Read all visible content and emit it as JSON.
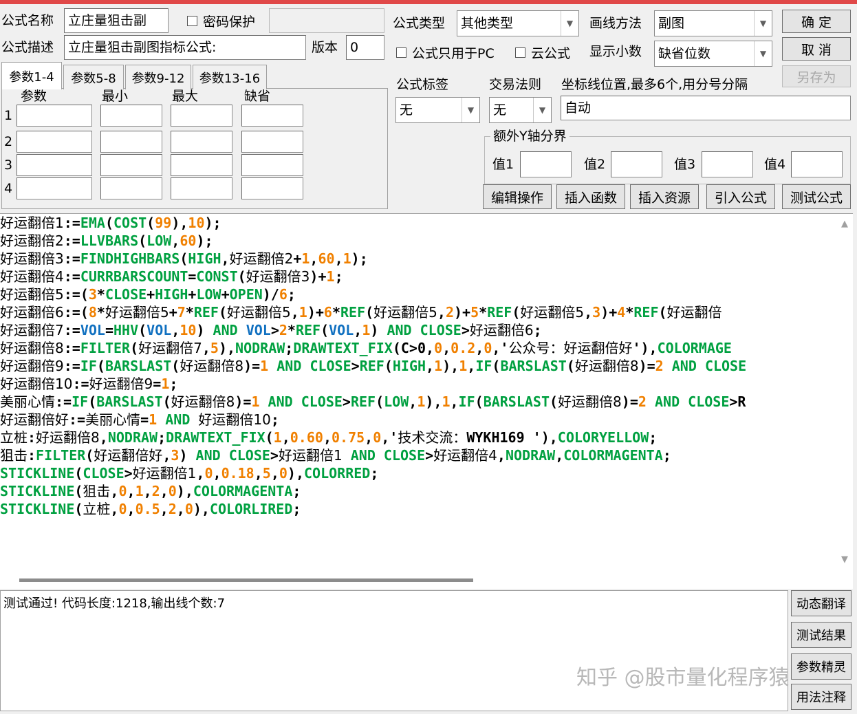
{
  "header": {
    "name_label": "公式名称",
    "name_value": "立庄量狙击副",
    "password_label": "密码保护",
    "desc_label": "公式描述",
    "desc_value": "立庄量狙击副图指标公式:",
    "version_label": "版本",
    "version_value": "0",
    "type_label": "公式类型",
    "type_value": "其他类型",
    "draw_label": "画线方法",
    "draw_value": "副图",
    "pc_only_label": "公式只用于PC",
    "cloud_label": "云公式",
    "decimals_label": "显示小数",
    "decimals_value": "缺省位数",
    "tag_label": "公式标签",
    "tag_value": "无",
    "trade_label": "交易法则",
    "trade_value": "无",
    "coord_label": "坐标线位置,最多6个,用分号分隔",
    "coord_value": "自动",
    "extra_y_label": "额外Y轴分界",
    "v1_label": "值1",
    "v2_label": "值2",
    "v3_label": "值3",
    "v4_label": "值4"
  },
  "buttons": {
    "ok": "确  定",
    "cancel": "取  消",
    "save_as": "另存为",
    "edit_ops": "编辑操作",
    "insert_func": "插入函数",
    "insert_res": "插入资源",
    "import_formula": "引入公式",
    "test_formula": "测试公式",
    "dyn_translate": "动态翻译",
    "test_result": "测试结果",
    "param_wizard": "参数精灵",
    "usage_notes": "用法注释"
  },
  "params": {
    "tabs": [
      "参数1-4",
      "参数5-8",
      "参数9-12",
      "参数13-16"
    ],
    "columns": [
      "参数",
      "最小",
      "最大",
      "缺省"
    ],
    "rows": [
      "1",
      "2",
      "3",
      "4"
    ]
  },
  "code_lines": [
    [
      [
        "v",
        "好运翻倍1"
      ],
      [
        "o",
        ":="
      ],
      [
        "k",
        "EMA"
      ],
      [
        "o",
        "("
      ],
      [
        "k",
        "COST"
      ],
      [
        "o",
        "("
      ],
      [
        "n",
        "99"
      ],
      [
        "o",
        "),"
      ],
      [
        "n",
        "10"
      ],
      [
        "o",
        ");"
      ]
    ],
    [
      [
        "v",
        "好运翻倍2"
      ],
      [
        "o",
        ":="
      ],
      [
        "k",
        "LLVBARS"
      ],
      [
        "o",
        "("
      ],
      [
        "k",
        "LOW"
      ],
      [
        "o",
        ","
      ],
      [
        "n",
        "60"
      ],
      [
        "o",
        ");"
      ]
    ],
    [
      [
        "v",
        "好运翻倍3"
      ],
      [
        "o",
        ":="
      ],
      [
        "k",
        "FINDHIGHBARS"
      ],
      [
        "o",
        "("
      ],
      [
        "k",
        "HIGH"
      ],
      [
        "o",
        ","
      ],
      [
        "v",
        "好运翻倍2"
      ],
      [
        "o",
        "+"
      ],
      [
        "n",
        "1"
      ],
      [
        "o",
        ","
      ],
      [
        "n",
        "60"
      ],
      [
        "o",
        ","
      ],
      [
        "n",
        "1"
      ],
      [
        "o",
        ");"
      ]
    ],
    [
      [
        "v",
        "好运翻倍4"
      ],
      [
        "o",
        ":="
      ],
      [
        "k",
        "CURRBARSCOUNT"
      ],
      [
        "o",
        "="
      ],
      [
        "k",
        "CONST"
      ],
      [
        "o",
        "("
      ],
      [
        "v",
        "好运翻倍3"
      ],
      [
        "o",
        ")+"
      ],
      [
        "n",
        "1"
      ],
      [
        "o",
        ";"
      ]
    ],
    [
      [
        "v",
        "好运翻倍5"
      ],
      [
        "o",
        ":=("
      ],
      [
        "n",
        "3"
      ],
      [
        "o",
        "*"
      ],
      [
        "k",
        "CLOSE"
      ],
      [
        "o",
        "+"
      ],
      [
        "k",
        "HIGH"
      ],
      [
        "o",
        "+"
      ],
      [
        "k",
        "LOW"
      ],
      [
        "o",
        "+"
      ],
      [
        "k",
        "OPEN"
      ],
      [
        "o",
        ")/"
      ],
      [
        "n",
        "6"
      ],
      [
        "o",
        ";"
      ]
    ],
    [
      [
        "v",
        "好运翻倍6"
      ],
      [
        "o",
        ":=("
      ],
      [
        "n",
        "8"
      ],
      [
        "o",
        "*"
      ],
      [
        "v",
        "好运翻倍5"
      ],
      [
        "o",
        "+"
      ],
      [
        "n",
        "7"
      ],
      [
        "o",
        "*"
      ],
      [
        "k",
        "REF"
      ],
      [
        "o",
        "("
      ],
      [
        "v",
        "好运翻倍5"
      ],
      [
        "o",
        ","
      ],
      [
        "n",
        "1"
      ],
      [
        "o",
        ")+"
      ],
      [
        "n",
        "6"
      ],
      [
        "o",
        "*"
      ],
      [
        "k",
        "REF"
      ],
      [
        "o",
        "("
      ],
      [
        "v",
        "好运翻倍5"
      ],
      [
        "o",
        ","
      ],
      [
        "n",
        "2"
      ],
      [
        "o",
        ")+"
      ],
      [
        "n",
        "5"
      ],
      [
        "o",
        "*"
      ],
      [
        "k",
        "REF"
      ],
      [
        "o",
        "("
      ],
      [
        "v",
        "好运翻倍5"
      ],
      [
        "o",
        ","
      ],
      [
        "n",
        "3"
      ],
      [
        "o",
        ")+"
      ],
      [
        "n",
        "4"
      ],
      [
        "o",
        "*"
      ],
      [
        "k",
        "REF"
      ],
      [
        "o",
        "("
      ],
      [
        "v",
        "好运翻倍"
      ]
    ],
    [
      [
        "v",
        "好运翻倍7"
      ],
      [
        "o",
        ":="
      ],
      [
        "b",
        "VOL"
      ],
      [
        "o",
        "="
      ],
      [
        "k",
        "HHV"
      ],
      [
        "o",
        "("
      ],
      [
        "b",
        "VOL"
      ],
      [
        "o",
        ","
      ],
      [
        "n",
        "10"
      ],
      [
        "o",
        ") "
      ],
      [
        "k",
        "AND"
      ],
      [
        "o",
        " "
      ],
      [
        "b",
        "VOL"
      ],
      [
        "o",
        ">"
      ],
      [
        "n",
        "2"
      ],
      [
        "o",
        "*"
      ],
      [
        "k",
        "REF"
      ],
      [
        "o",
        "("
      ],
      [
        "b",
        "VOL"
      ],
      [
        "o",
        ","
      ],
      [
        "n",
        "1"
      ],
      [
        "o",
        ") "
      ],
      [
        "k",
        "AND"
      ],
      [
        "o",
        " "
      ],
      [
        "k",
        "CLOSE"
      ],
      [
        "o",
        ">"
      ],
      [
        "v",
        "好运翻倍6"
      ],
      [
        "o",
        ";"
      ]
    ],
    [
      [
        "v",
        "好运翻倍8"
      ],
      [
        "o",
        ":="
      ],
      [
        "k",
        "FILTER"
      ],
      [
        "o",
        "("
      ],
      [
        "v",
        "好运翻倍7"
      ],
      [
        "o",
        ","
      ],
      [
        "n",
        "5"
      ],
      [
        "o",
        "),"
      ],
      [
        "k",
        "NODRAW"
      ],
      [
        "o",
        ";"
      ],
      [
        "k",
        "DRAWTEXT_FIX"
      ],
      [
        "o",
        "(C>0,"
      ],
      [
        "n",
        "0"
      ],
      [
        "o",
        ","
      ],
      [
        "n",
        "0.2"
      ],
      [
        "o",
        ","
      ],
      [
        "n",
        "0"
      ],
      [
        "o",
        ",'"
      ],
      [
        "s",
        "公众号：好运翻倍好"
      ],
      [
        "o",
        "'),"
      ],
      [
        "k",
        "COLORMAGE"
      ]
    ],
    [
      [
        "v",
        "好运翻倍9"
      ],
      [
        "o",
        ":="
      ],
      [
        "k",
        "IF"
      ],
      [
        "o",
        "("
      ],
      [
        "k",
        "BARSLAST"
      ],
      [
        "o",
        "("
      ],
      [
        "v",
        "好运翻倍8"
      ],
      [
        "o",
        ")="
      ],
      [
        "n",
        "1"
      ],
      [
        "o",
        " "
      ],
      [
        "k",
        "AND"
      ],
      [
        "o",
        " "
      ],
      [
        "k",
        "CLOSE"
      ],
      [
        "o",
        ">"
      ],
      [
        "k",
        "REF"
      ],
      [
        "o",
        "("
      ],
      [
        "k",
        "HIGH"
      ],
      [
        "o",
        ","
      ],
      [
        "n",
        "1"
      ],
      [
        "o",
        "),"
      ],
      [
        "n",
        "1"
      ],
      [
        "o",
        ","
      ],
      [
        "k",
        "IF"
      ],
      [
        "o",
        "("
      ],
      [
        "k",
        "BARSLAST"
      ],
      [
        "o",
        "("
      ],
      [
        "v",
        "好运翻倍8"
      ],
      [
        "o",
        ")="
      ],
      [
        "n",
        "2"
      ],
      [
        "o",
        " "
      ],
      [
        "k",
        "AND"
      ],
      [
        "o",
        " "
      ],
      [
        "k",
        "CLOSE"
      ]
    ],
    [
      [
        "v",
        "好运翻倍10"
      ],
      [
        "o",
        ":="
      ],
      [
        "v",
        "好运翻倍9"
      ],
      [
        "o",
        "="
      ],
      [
        "n",
        "1"
      ],
      [
        "o",
        ";"
      ]
    ],
    [
      [
        "v",
        "美丽心情"
      ],
      [
        "o",
        ":="
      ],
      [
        "k",
        "IF"
      ],
      [
        "o",
        "("
      ],
      [
        "k",
        "BARSLAST"
      ],
      [
        "o",
        "("
      ],
      [
        "v",
        "好运翻倍8"
      ],
      [
        "o",
        ")="
      ],
      [
        "n",
        "1"
      ],
      [
        "o",
        " "
      ],
      [
        "k",
        "AND"
      ],
      [
        "o",
        " "
      ],
      [
        "k",
        "CLOSE"
      ],
      [
        "o",
        ">"
      ],
      [
        "k",
        "REF"
      ],
      [
        "o",
        "("
      ],
      [
        "k",
        "LOW"
      ],
      [
        "o",
        ","
      ],
      [
        "n",
        "1"
      ],
      [
        "o",
        "),"
      ],
      [
        "n",
        "1"
      ],
      [
        "o",
        ","
      ],
      [
        "k",
        "IF"
      ],
      [
        "o",
        "("
      ],
      [
        "k",
        "BARSLAST"
      ],
      [
        "o",
        "("
      ],
      [
        "v",
        "好运翻倍8"
      ],
      [
        "o",
        ")="
      ],
      [
        "n",
        "2"
      ],
      [
        "o",
        " "
      ],
      [
        "k",
        "AND"
      ],
      [
        "o",
        " "
      ],
      [
        "k",
        "CLOSE"
      ],
      [
        "o",
        ">R"
      ]
    ],
    [
      [
        "v",
        "好运翻倍好"
      ],
      [
        "o",
        ":="
      ],
      [
        "v",
        "美丽心情"
      ],
      [
        "o",
        "="
      ],
      [
        "n",
        "1"
      ],
      [
        "o",
        " "
      ],
      [
        "k",
        "AND"
      ],
      [
        "o",
        " "
      ],
      [
        "v",
        "好运翻倍10"
      ],
      [
        "o",
        ";"
      ]
    ],
    [
      [
        "v",
        "立桩"
      ],
      [
        "o",
        ":"
      ],
      [
        "v",
        "好运翻倍8"
      ],
      [
        "o",
        ","
      ],
      [
        "k",
        "NODRAW"
      ],
      [
        "o",
        ";"
      ],
      [
        "k",
        "DRAWTEXT_FIX"
      ],
      [
        "o",
        "("
      ],
      [
        "n",
        "1"
      ],
      [
        "o",
        ","
      ],
      [
        "n",
        "0.60"
      ],
      [
        "o",
        ","
      ],
      [
        "n",
        "0.75"
      ],
      [
        "o",
        ","
      ],
      [
        "n",
        "0"
      ],
      [
        "o",
        ",'"
      ],
      [
        "s",
        "技术交流："
      ],
      [
        "o",
        "WYKH169 '),"
      ],
      [
        "k",
        "COLORYELLOW"
      ],
      [
        "o",
        ";"
      ]
    ],
    [
      [
        "v",
        "狙击"
      ],
      [
        "o",
        ":"
      ],
      [
        "k",
        "FILTER"
      ],
      [
        "o",
        "("
      ],
      [
        "v",
        "好运翻倍好"
      ],
      [
        "o",
        ","
      ],
      [
        "n",
        "3"
      ],
      [
        "o",
        ") "
      ],
      [
        "k",
        "AND"
      ],
      [
        "o",
        " "
      ],
      [
        "k",
        "CLOSE"
      ],
      [
        "o",
        ">"
      ],
      [
        "v",
        "好运翻倍1"
      ],
      [
        "o",
        " "
      ],
      [
        "k",
        "AND"
      ],
      [
        "o",
        " "
      ],
      [
        "k",
        "CLOSE"
      ],
      [
        "o",
        ">"
      ],
      [
        "v",
        "好运翻倍4"
      ],
      [
        "o",
        ","
      ],
      [
        "k",
        "NODRAW"
      ],
      [
        "o",
        ","
      ],
      [
        "k",
        "COLORMAGENTA"
      ],
      [
        "o",
        ";"
      ]
    ],
    [
      [
        "k",
        "STICKLINE"
      ],
      [
        "o",
        "("
      ],
      [
        "k",
        "CLOSE"
      ],
      [
        "o",
        ">"
      ],
      [
        "v",
        "好运翻倍1"
      ],
      [
        "o",
        ","
      ],
      [
        "n",
        "0"
      ],
      [
        "o",
        ","
      ],
      [
        "n",
        "0.18"
      ],
      [
        "o",
        ","
      ],
      [
        "n",
        "5"
      ],
      [
        "o",
        ","
      ],
      [
        "n",
        "0"
      ],
      [
        "o",
        "),"
      ],
      [
        "k",
        "COLORRED"
      ],
      [
        "o",
        ";"
      ]
    ],
    [
      [
        "k",
        "STICKLINE"
      ],
      [
        "o",
        "("
      ],
      [
        "v",
        "狙击"
      ],
      [
        "o",
        ","
      ],
      [
        "n",
        "0"
      ],
      [
        "o",
        ","
      ],
      [
        "n",
        "1"
      ],
      [
        "o",
        ","
      ],
      [
        "n",
        "2"
      ],
      [
        "o",
        ","
      ],
      [
        "n",
        "0"
      ],
      [
        "o",
        "),"
      ],
      [
        "k",
        "COLORMAGENTA"
      ],
      [
        "o",
        ";"
      ]
    ],
    [
      [
        "k",
        "STICKLINE"
      ],
      [
        "o",
        "("
      ],
      [
        "v",
        "立桩"
      ],
      [
        "o",
        ","
      ],
      [
        "n",
        "0"
      ],
      [
        "o",
        ","
      ],
      [
        "n",
        "0.5"
      ],
      [
        "o",
        ","
      ],
      [
        "n",
        "2"
      ],
      [
        "o",
        ","
      ],
      [
        "n",
        "0"
      ],
      [
        "o",
        "),"
      ],
      [
        "k",
        "COLORLIRED"
      ],
      [
        "o",
        ";"
      ]
    ]
  ],
  "output": {
    "text": "测试通过! 代码长度:1218,输出线个数:7"
  },
  "watermark": "知乎 @股市量化程序猿",
  "icons": {
    "dropdown": "chevron-down-icon",
    "scroll_up": "scroll-up-icon",
    "scroll_down": "scroll-down-icon"
  },
  "colors": {
    "keyword": "#00a040",
    "number": "#f08000",
    "blue_keyword": "#1070c0",
    "title_bar": "#e04848"
  }
}
